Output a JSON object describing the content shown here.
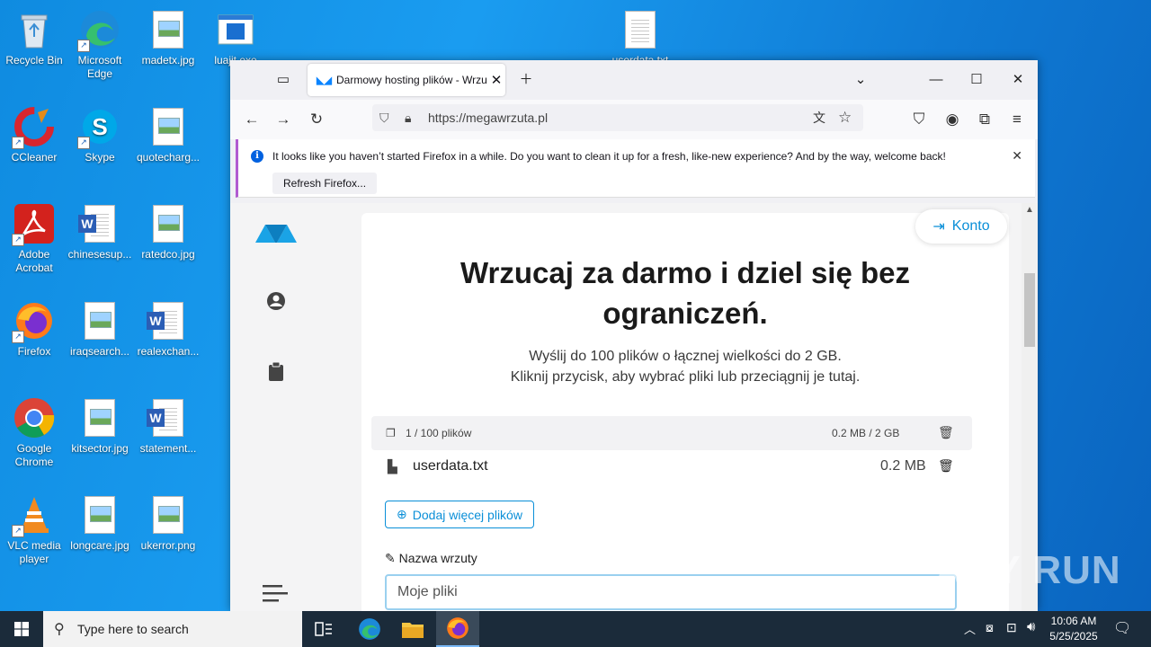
{
  "desktop": {
    "icons": [
      {
        "label": "Recycle Bin"
      },
      {
        "label": "Microsoft Edge"
      },
      {
        "label": "madetx.jpg"
      },
      {
        "label": "luajit.exe"
      },
      {
        "label": "userdata.txt"
      },
      {
        "label": "CCleaner"
      },
      {
        "label": "Skype"
      },
      {
        "label": "quotecharg..."
      },
      {
        "label": "Adobe Acrobat"
      },
      {
        "label": "chinesesup..."
      },
      {
        "label": "ratedco.jpg"
      },
      {
        "label": "Firefox"
      },
      {
        "label": "iraqsearch..."
      },
      {
        "label": "realexchan..."
      },
      {
        "label": "Google Chrome"
      },
      {
        "label": "kitsector.jpg"
      },
      {
        "label": "statement..."
      },
      {
        "label": "VLC media player"
      },
      {
        "label": "longcare.jpg"
      },
      {
        "label": "ukerror.png"
      }
    ]
  },
  "browser": {
    "tab_title": "Darmowy hosting plików - Wrzuta",
    "url": "https://megawrzuta.pl",
    "notification": {
      "message": "It looks like you haven’t started Firefox in a while. Do you want to clean it up for a fresh, like-new experience? And by the way, welcome back!",
      "button": "Refresh Firefox..."
    }
  },
  "page": {
    "account_button": "Konto",
    "heading_line1": "Wrzucaj za darmo i dziel się bez",
    "heading_line2": "ograniczeń.",
    "sub_line1": "Wyślij do 100 plików o łącznej wielkości do 2 GB.",
    "sub_line2": "Kliknij przycisk, aby wybrać pliki lub przeciągnij je tutaj.",
    "file_count": "1 / 100 plików",
    "size_total": "0.2 MB / 2 GB",
    "file": {
      "name": "userdata.txt",
      "size": "0.2 MB"
    },
    "add_files_button": "Dodaj więcej plików",
    "name_label": "Nazwa wrzuty",
    "name_placeholder": "Moje pliki"
  },
  "taskbar": {
    "search_placeholder": "Type here to search",
    "time": "10:06 AM",
    "date": "5/25/2025"
  },
  "watermark": "ANY RUN",
  "colors": {
    "accent": "#0a8fd8",
    "taskbar": "#1b2b3a",
    "desktop": "#1a86d6"
  }
}
